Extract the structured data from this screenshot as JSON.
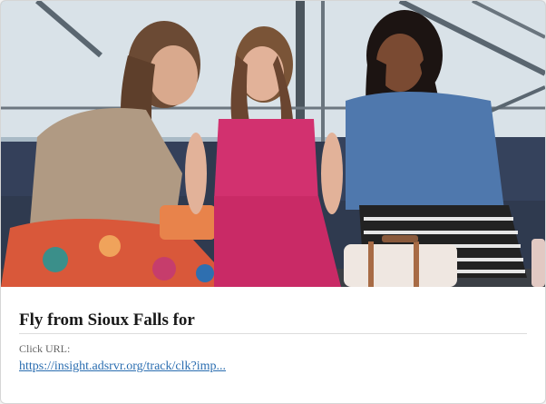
{
  "ad": {
    "headline": "Fly from Sioux Falls for",
    "url_label": "Click URL:",
    "url_text": "https://insight.adsrvr.org/track/clk?imp..."
  },
  "image": {
    "subject": "three women chatting in an airport lounge"
  },
  "colors": {
    "link": "#2a6db0",
    "headline": "#1a1a1a",
    "border": "#d6d6d6"
  }
}
